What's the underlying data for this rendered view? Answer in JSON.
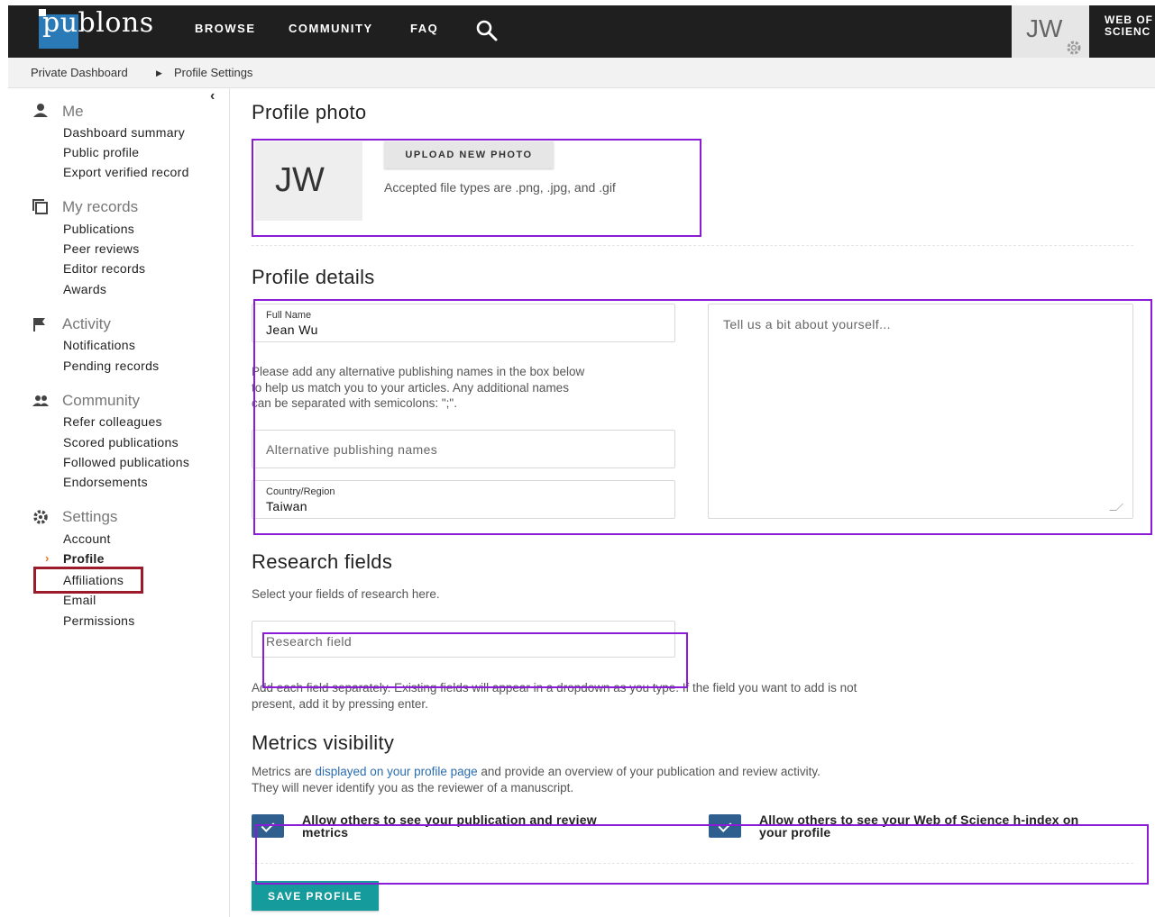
{
  "header": {
    "logo_text": "publons",
    "nav": [
      "BROWSE",
      "COMMUNITY",
      "FAQ"
    ],
    "user_initials": "JW",
    "brand_line1": "WEB OF",
    "brand_line2": "SCIENC"
  },
  "breadcrumb": [
    "Private Dashboard",
    "Profile Settings"
  ],
  "sidebar": {
    "me": {
      "title": "Me",
      "items": [
        "Dashboard summary",
        "Public profile",
        "Export verified record"
      ]
    },
    "records": {
      "title": "My records",
      "items": [
        "Publications",
        "Peer reviews",
        "Editor records",
        "Awards"
      ]
    },
    "activity": {
      "title": "Activity",
      "items": [
        "Notifications",
        "Pending records"
      ]
    },
    "community": {
      "title": "Community",
      "items": [
        "Refer colleagues",
        "Scored publications",
        "Followed publications",
        "Endorsements"
      ]
    },
    "settings": {
      "title": "Settings",
      "items": [
        "Account",
        "Profile",
        "Affiliations",
        "Email",
        "Permissions"
      ]
    },
    "active_item": "Profile"
  },
  "photo": {
    "title": "Profile photo",
    "initials": "JW",
    "upload_label": "UPLOAD NEW PHOTO",
    "note": "Accepted file types are .png, .jpg, and .gif"
  },
  "details": {
    "title": "Profile details",
    "full_name_label": "Full Name",
    "full_name_value": "Jean Wu",
    "alt_help_1": "Please add any alternative publishing names in the box below",
    "alt_help_2": "to help us match you to your articles. Any additional names",
    "alt_help_3": "can be separated with semicolons: \";\".",
    "alt_placeholder": "Alternative publishing names",
    "country_label": "Country/Region",
    "country_value": "Taiwan",
    "bio_placeholder": "Tell us a bit about yourself..."
  },
  "research": {
    "title": "Research fields",
    "subtitle": "Select your fields of research here.",
    "placeholder": "Research field",
    "help_1": "Add each field separately. Existing fields will appear in a dropdown as you type. If the field you want to add is not",
    "help_2": "present, add it by pressing enter."
  },
  "metrics": {
    "title": "Metrics visibility",
    "line1_a": "Metrics are ",
    "line1_link": "displayed on your profile page",
    "line1_b": " and provide an overview of your publication and review activity.",
    "line2": "They will never identify you as the reviewer of a manuscript.",
    "check1_1": "Allow others to see your publication and review",
    "check1_2": "metrics",
    "check2_1": "Allow others to see your Web of Science h-index on",
    "check2_2": "your profile",
    "check1_checked": true,
    "check2_checked": true
  },
  "save_label": "SAVE PROFILE",
  "colors": {
    "topbar": "#1f1f1f",
    "accent_teal": "#159b9b",
    "checkbox": "#2f5f8e",
    "annotation_purple": "#8a1bd6",
    "annotation_red": "#9b1b2a"
  }
}
